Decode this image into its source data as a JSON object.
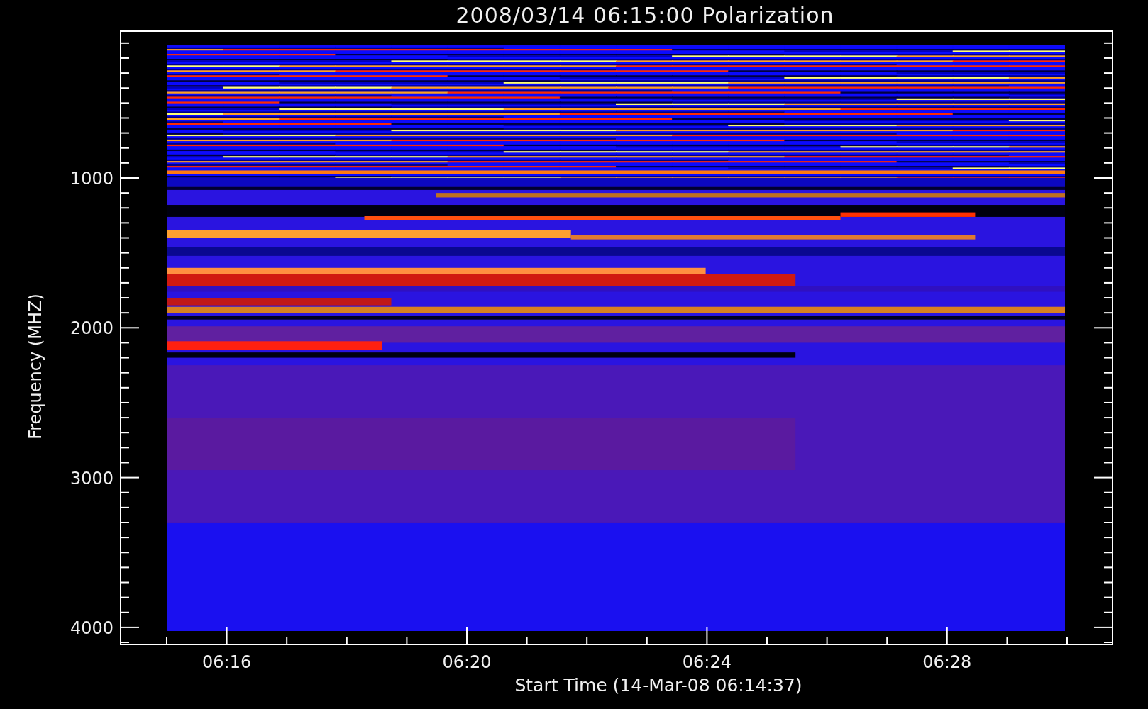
{
  "title": "2008/03/14 06:15:00 Polarization",
  "y_axis": {
    "label": "Frequency (MHZ)",
    "ticks": [
      "1000",
      "2000",
      "3000",
      "4000"
    ]
  },
  "x_axis": {
    "label": "Start Time (14-Mar-08 06:14:37)",
    "ticks": [
      "06:16",
      "06:20",
      "06:24",
      "06:28"
    ]
  }
}
